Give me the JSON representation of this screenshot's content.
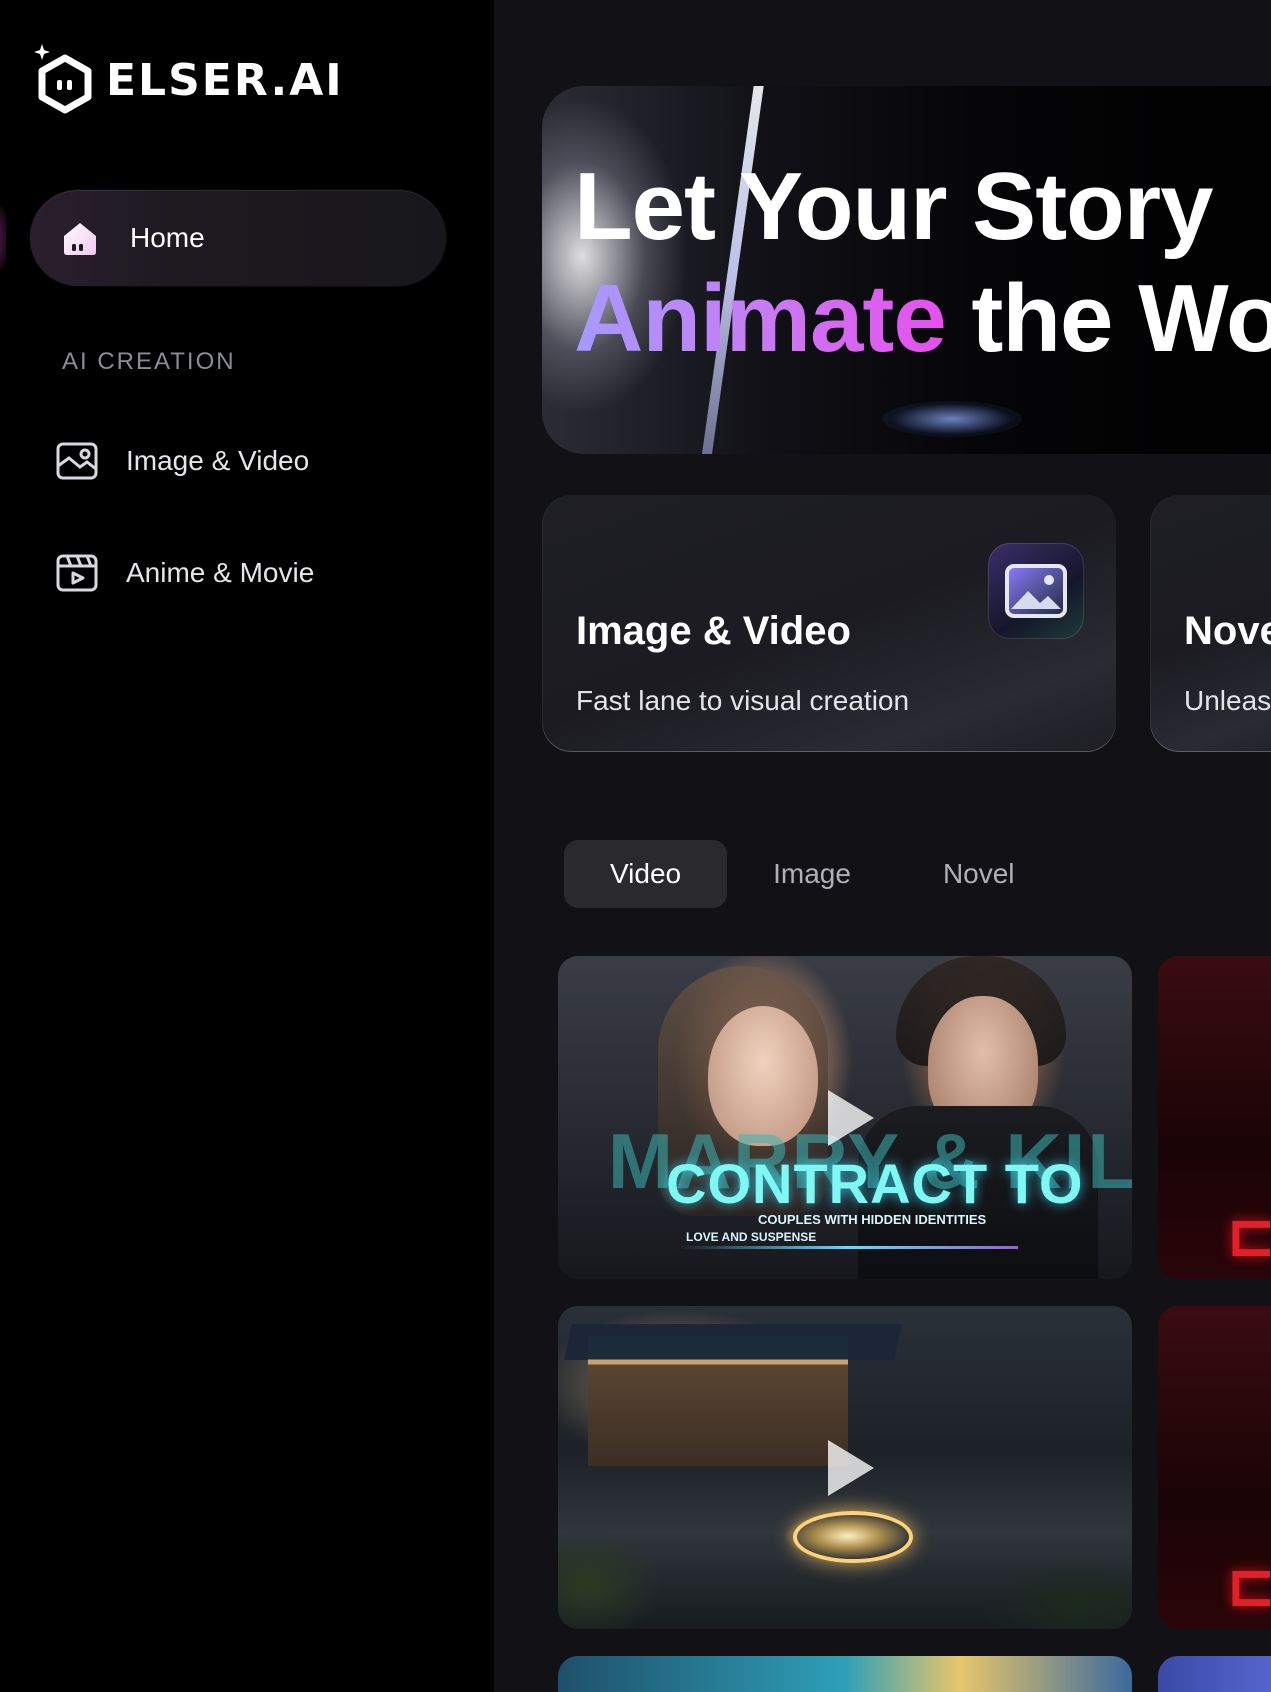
{
  "brand": {
    "name": "ELSER.AI"
  },
  "sidebar": {
    "home_label": "Home",
    "section_label": "AI CREATION",
    "items": [
      {
        "label": "Image & Video",
        "icon": "image-video-icon"
      },
      {
        "label": "Anime & Movie",
        "icon": "clapperboard-icon"
      }
    ]
  },
  "hero": {
    "line1": "Let Your Story",
    "line2_highlight": "Animate",
    "line2_rest": " the Wo"
  },
  "cards": [
    {
      "title": "Image & Video",
      "subtitle": "Fast lane to visual creation",
      "icon": "picture-icon"
    },
    {
      "title": "Nove",
      "subtitle": "Unleas"
    }
  ],
  "tabs": [
    {
      "label": "Video",
      "active": true
    },
    {
      "label": "Image",
      "active": false
    },
    {
      "label": "Novel",
      "active": false
    }
  ],
  "thumbnails": {
    "first": {
      "ghost_text": "MARRY & KILL",
      "title": "CONTRACT TO",
      "subtitle": "COUPLES WITH HIDDEN IDENTITIES",
      "tagline": "LOVE AND SUSPENSE"
    }
  },
  "colors": {
    "accent_gradient_start": "#a59bff",
    "accent_gradient_end": "#e84fee",
    "sidebar_bg": "#000000",
    "main_bg": "#121216"
  }
}
